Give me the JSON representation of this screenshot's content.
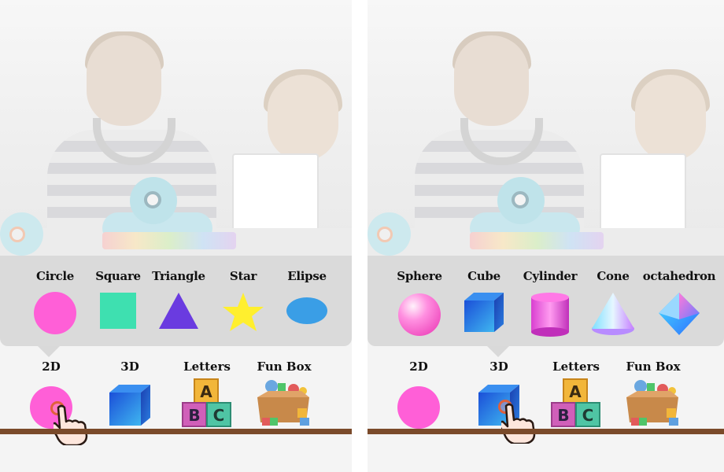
{
  "left_panel": {
    "shapes": [
      {
        "label": "Circle",
        "icon": "circle-2d-icon",
        "color": "#ff5fd7"
      },
      {
        "label": "Square",
        "icon": "square-2d-icon",
        "color": "#3ee0b0"
      },
      {
        "label": "Triangle",
        "icon": "triangle-2d-icon",
        "color": "#6a3be0"
      },
      {
        "label": "Star",
        "icon": "star-2d-icon",
        "color": "#ffef2e"
      },
      {
        "label": "Elipse",
        "icon": "ellipse-2d-icon",
        "color": "#3a9ee6"
      }
    ],
    "categories": [
      {
        "label": "2D",
        "icon": "pink-circle-icon"
      },
      {
        "label": "3D",
        "icon": "blue-cube-icon"
      },
      {
        "label": "Letters",
        "icon": "abc-blocks-icon"
      },
      {
        "label": "Fun Box",
        "icon": "toy-box-icon"
      }
    ],
    "selected_category": "2D"
  },
  "right_panel": {
    "shapes": [
      {
        "label": "Sphere",
        "icon": "sphere-3d-icon"
      },
      {
        "label": "Cube",
        "icon": "cube-3d-icon"
      },
      {
        "label": "Cylinder",
        "icon": "cylinder-3d-icon"
      },
      {
        "label": "Cone",
        "icon": "cone-3d-icon"
      },
      {
        "label": "octahedron",
        "icon": "octahedron-3d-icon"
      }
    ],
    "categories": [
      {
        "label": "2D",
        "icon": "pink-circle-icon"
      },
      {
        "label": "3D",
        "icon": "blue-cube-icon"
      },
      {
        "label": "Letters",
        "icon": "abc-blocks-icon"
      },
      {
        "label": "Fun Box",
        "icon": "toy-box-icon"
      }
    ],
    "selected_category": "3D"
  },
  "blocks": {
    "a": "A",
    "b": "B",
    "c": "C"
  },
  "colors": {
    "shelf": "#7a4a2a",
    "popup": "#d9d9d9",
    "pink": "#ff5fd7",
    "cube_blue": "#1f6fe0"
  }
}
